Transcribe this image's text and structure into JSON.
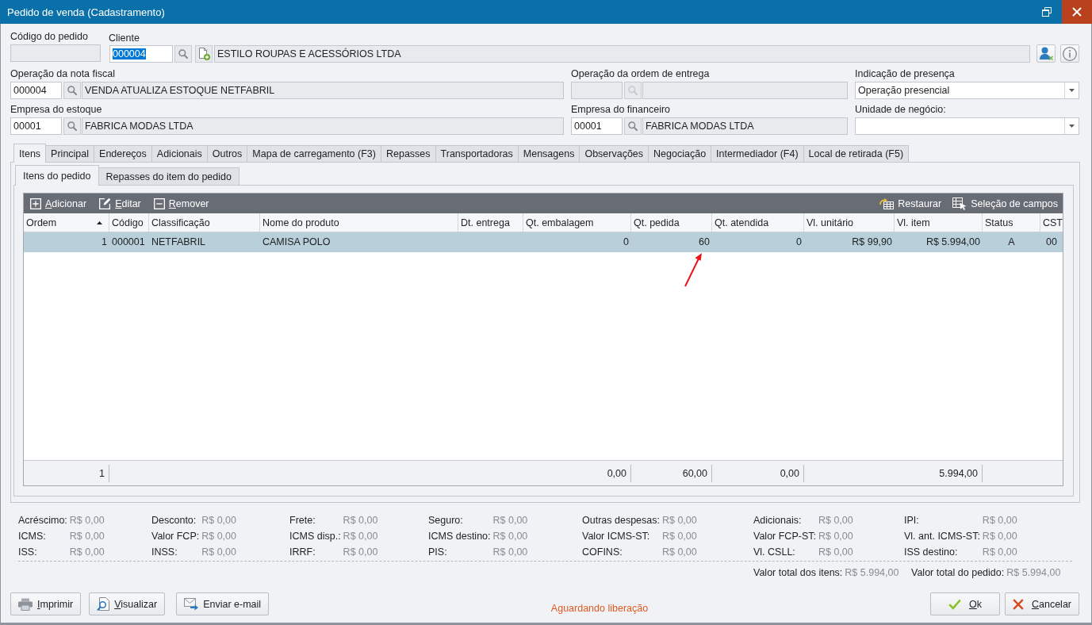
{
  "window": {
    "title": "Pedido de venda (Cadastramento)"
  },
  "order_code": {
    "label": "Código do pedido",
    "disabled": true
  },
  "client": {
    "label": "Cliente",
    "code": "000004",
    "code_highlighted": true,
    "name": "ESTILO ROUPAS E ACESSÓRIOS LTDA"
  },
  "field_rows": [
    [
      {
        "kind": "lookup",
        "label": "Operação da nota fiscal",
        "code": "000004",
        "description": "VENDA ATUALIZA ESTOQUE NETFABRIL",
        "disabled": false
      },
      {
        "kind": "lookup",
        "label": "Operação da ordem de entrega",
        "disabled": true
      },
      {
        "kind": "combo",
        "label": "Indicação de presença",
        "value": "Operação presencial"
      }
    ],
    [
      {
        "kind": "lookup",
        "label": "Empresa do estoque",
        "code": "00001",
        "description": "FABRICA MODAS LTDA",
        "disabled": false
      },
      {
        "kind": "lookup",
        "label": "Empresa do financeiro",
        "code": "00001",
        "description": "FABRICA MODAS LTDA",
        "disabled": false
      },
      {
        "kind": "combo",
        "label": "Unidade de negócio:"
      }
    ]
  ],
  "tabs": [
    {
      "label": "Itens",
      "selected": true
    },
    {
      "label": "Principal",
      "selected": false
    },
    {
      "label": "Endereços",
      "selected": false
    },
    {
      "label": "Adicionais",
      "selected": false
    },
    {
      "label": "Outros",
      "selected": false
    },
    {
      "label": "Mapa de carregamento (F3)",
      "selected": false
    },
    {
      "label": "Repasses",
      "selected": false
    },
    {
      "label": "Transportadoras",
      "selected": false
    },
    {
      "label": "Mensagens",
      "selected": false
    },
    {
      "label": "Observações",
      "selected": false
    },
    {
      "label": "Negociação",
      "selected": false
    },
    {
      "label": "Intermediador (F4)",
      "selected": false
    },
    {
      "label": "Local de retirada (F5)",
      "selected": false
    }
  ],
  "subtabs": [
    {
      "label": "Itens do pedido",
      "selected": true
    },
    {
      "label": "Repasses do item do pedido",
      "selected": false
    }
  ],
  "grid": {
    "toolbar_left": [
      {
        "label": "Adicionar",
        "kind": "add",
        "mnemonic": true
      },
      {
        "label": "Editar",
        "kind": "edit",
        "mnemonic": true
      },
      {
        "label": "Remover",
        "kind": "remove",
        "mnemonic": true
      }
    ],
    "toolbar_right": [
      {
        "label": "Restaurar",
        "kind": "restore",
        "mnemonic": false
      },
      {
        "label": "Seleção de campos",
        "kind": "fields",
        "mnemonic": false
      }
    ],
    "columns": [
      {
        "label": "Ordem",
        "kind": "number",
        "sorted": true,
        "total": "1"
      },
      {
        "label": "Código",
        "kind": "text",
        "sorted": false
      },
      {
        "label": "Classificação",
        "kind": "text",
        "sorted": false
      },
      {
        "label": "Nome do produto",
        "kind": "text",
        "sorted": false
      },
      {
        "label": "Dt. entrega",
        "kind": "text",
        "sorted": false
      },
      {
        "label": "Qt. embalagem",
        "kind": "number",
        "sorted": false,
        "total": "0,00"
      },
      {
        "label": "Qt. pedida",
        "kind": "number",
        "sorted": false,
        "total": "60,00"
      },
      {
        "label": "Qt. atendida",
        "kind": "number",
        "sorted": false,
        "total": "0,00"
      },
      {
        "label": "Vl. unitário",
        "kind": "number",
        "sorted": false
      },
      {
        "label": "Vl. item",
        "kind": "number",
        "sorted": false,
        "total": "5.994,00"
      },
      {
        "label": "Status",
        "kind": "flag",
        "sorted": false
      },
      {
        "label": "CST",
        "kind": "flag",
        "sorted": false
      }
    ],
    "rows": [
      {
        "selected": true,
        "cells": [
          "1",
          "000001",
          "NETFABRIL",
          "CAMISA POLO",
          null,
          "0",
          "60",
          "0",
          "R$ 99,90",
          "R$ 5.994,00",
          "A",
          "00"
        ]
      }
    ]
  },
  "summary": {
    "columns": [
      [
        {
          "label": "Acréscimo:",
          "value": "R$ 0,00"
        },
        {
          "label": "ICMS:",
          "value": "R$ 0,00"
        },
        {
          "label": "ISS:",
          "value": "R$ 0,00"
        }
      ],
      [
        {
          "label": "Desconto:",
          "value": "R$ 0,00"
        },
        {
          "label": "Valor FCP:",
          "value": "R$ 0,00"
        },
        {
          "label": "INSS:",
          "value": "R$ 0,00"
        }
      ],
      [
        {
          "label": "Frete:",
          "value": "R$ 0,00"
        },
        {
          "label": "ICMS disp.:",
          "value": "R$ 0,00"
        },
        {
          "label": "IRRF:",
          "value": "R$ 0,00"
        }
      ],
      [
        {
          "label": "Seguro:",
          "value": "R$ 0,00"
        },
        {
          "label": "ICMS destino:",
          "value": "R$ 0,00"
        },
        {
          "label": "PIS:",
          "value": "R$ 0,00"
        }
      ],
      [
        {
          "label": "Outras despesas:",
          "value": "R$ 0,00"
        },
        {
          "label": "Valor ICMS-ST:",
          "value": "R$ 0,00"
        },
        {
          "label": "COFINS:",
          "value": "R$ 0,00"
        }
      ],
      [
        {
          "label": "Adicionais:",
          "value": "R$ 0,00"
        },
        {
          "label": "Valor FCP-ST:",
          "value": "R$ 0,00"
        },
        {
          "label": "Vl. CSLL:",
          "value": "R$ 0,00"
        }
      ],
      [
        {
          "label": "IPI:",
          "value": "R$ 0,00"
        },
        {
          "label": "Vl. ant. ICMS-ST:",
          "value": "R$ 0,00"
        },
        {
          "label": "ISS destino:",
          "value": "R$ 0,00"
        }
      ]
    ],
    "totals": [
      {
        "label": "Valor total dos itens:",
        "value": "R$ 5.994,00"
      },
      {
        "label": "Valor total do pedido:",
        "value": "R$ 5.994,00"
      }
    ]
  },
  "actions_left": [
    {
      "label": "Imprimir",
      "kind": "print",
      "mnemonic": true
    },
    {
      "label": "Visualizar",
      "kind": "preview",
      "mnemonic": true
    },
    {
      "label": "Enviar e-mail",
      "kind": "email",
      "mnemonic": false
    }
  ],
  "status": "Aguardando liberação",
  "actions_right": [
    {
      "label": "Ok",
      "kind": "ok",
      "mnemonic": true
    },
    {
      "label": "Cancelar",
      "kind": "cancel",
      "mnemonic": true
    }
  ]
}
